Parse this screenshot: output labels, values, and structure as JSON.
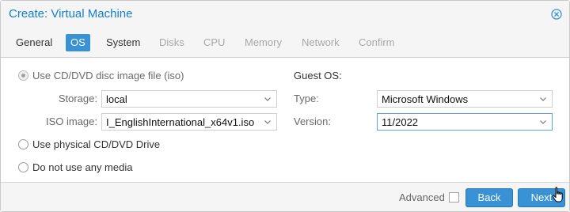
{
  "dialog": {
    "title": "Create: Virtual Machine"
  },
  "tabs": [
    {
      "label": "General",
      "state": "normal"
    },
    {
      "label": "OS",
      "state": "active"
    },
    {
      "label": "System",
      "state": "normal"
    },
    {
      "label": "Disks",
      "state": "disabled"
    },
    {
      "label": "CPU",
      "state": "disabled"
    },
    {
      "label": "Memory",
      "state": "disabled"
    },
    {
      "label": "Network",
      "state": "disabled"
    },
    {
      "label": "Confirm",
      "state": "disabled"
    }
  ],
  "media": {
    "iso_option": {
      "label": "Use CD/DVD disc image file (iso)",
      "selected": true
    },
    "storage": {
      "label": "Storage:",
      "value": "local"
    },
    "iso_image": {
      "label": "ISO image:",
      "value": "I_EnglishInternational_x64v1.iso"
    },
    "physical_option": {
      "label": "Use physical CD/DVD Drive",
      "selected": false
    },
    "none_option": {
      "label": "Do not use any media",
      "selected": false
    }
  },
  "guest_os": {
    "heading": "Guest OS:",
    "type": {
      "label": "Type:",
      "value": "Microsoft Windows"
    },
    "version": {
      "label": "Version:",
      "value": "11/2022"
    }
  },
  "footer": {
    "advanced_label": "Advanced",
    "advanced_checked": false,
    "back_label": "Back",
    "next_label": "Next"
  },
  "colors": {
    "accent": "#3892d4",
    "title": "#157fcc"
  }
}
